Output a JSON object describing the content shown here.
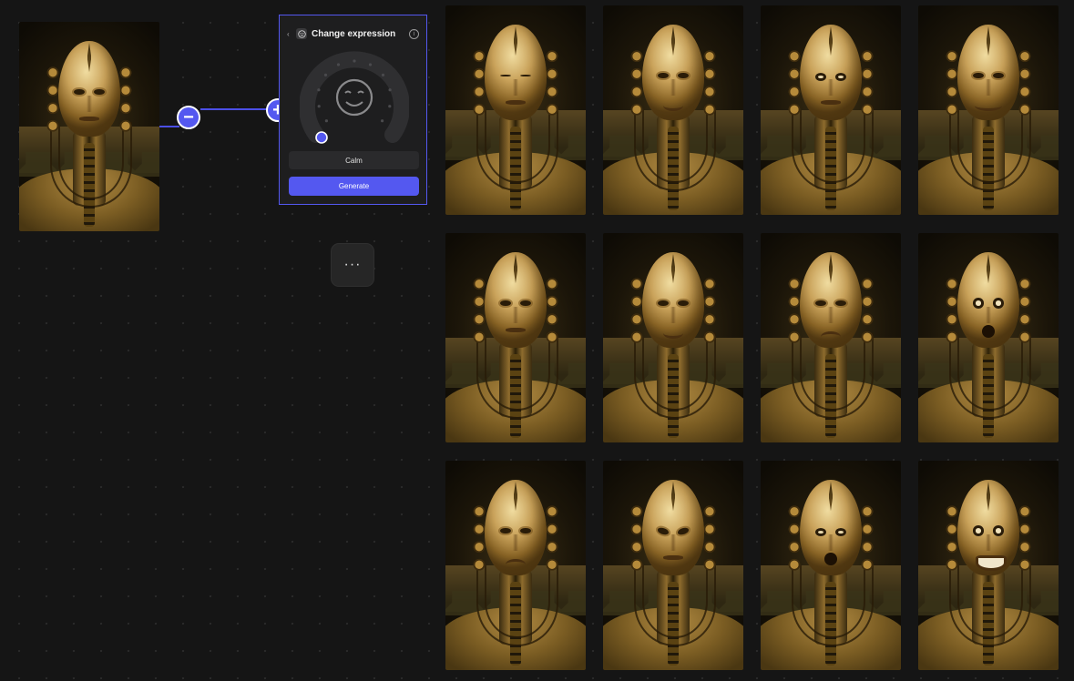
{
  "node": {
    "title": "Change expression",
    "selected_expression": "Calm",
    "generate_label": "Generate",
    "remove_symbol": "−",
    "add_symbol": "+",
    "more_symbol": "···",
    "info_symbol": "i",
    "back_symbol": "‹"
  },
  "colors": {
    "accent": "#5458f0",
    "background": "#151515",
    "card": "#1e1e1f"
  },
  "dial": {
    "icon": "smiley-face-icon",
    "dot_count": 11,
    "selected_index": 0
  },
  "results": [
    {
      "expression": "closed-eyes"
    },
    {
      "expression": "smile"
    },
    {
      "expression": "surprised"
    },
    {
      "expression": "grin"
    },
    {
      "expression": "neutral"
    },
    {
      "expression": "smile"
    },
    {
      "expression": "sad"
    },
    {
      "expression": "shock"
    },
    {
      "expression": "frown"
    },
    {
      "expression": "angry"
    },
    {
      "expression": "gasp"
    },
    {
      "expression": "joy"
    }
  ]
}
